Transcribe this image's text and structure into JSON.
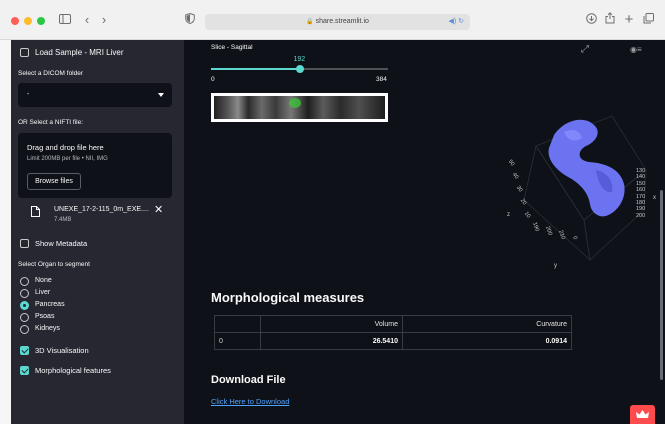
{
  "browser": {
    "url": "share.streamlit.io",
    "icons": [
      "sidebar-icon",
      "back-icon",
      "forward-icon",
      "shield-icon",
      "download-icon",
      "share-icon",
      "new-tab-icon",
      "tabs-icon"
    ]
  },
  "sidebar": {
    "load_sample_label": "Load Sample - MRI Liver",
    "dicom_label": "Select a DICOM folder",
    "dicom_value": "-",
    "nifti_label": "OR Select a NIFTI file:",
    "drop_title": "Drag and drop file here",
    "drop_hint": "Limit 200MB per file • NII, IMG",
    "browse_label": "Browse files",
    "file_name": "UNEXE_17-2-115_0m_EXE....",
    "file_size": "7.4MB",
    "show_metadata_label": "Show Metadata",
    "organ_label": "Select Organ to segment",
    "organs": [
      "None",
      "Liver",
      "Pancreas",
      "Psoas",
      "Kidneys"
    ],
    "organ_selected": "Pancreas",
    "vis3d_label": "3D Visualisation",
    "morph_label": "Morphological features"
  },
  "main": {
    "slider_label": "Slice - Sagittal",
    "slider_value": 192,
    "slider_min": "0",
    "slider_max": "384",
    "plot_axis_ticks_right": [
      "130",
      "140",
      "150",
      "160",
      "170",
      "180",
      "190",
      "200"
    ],
    "plot_axis_ticks_bottom": [
      "190",
      "200",
      "210",
      "0"
    ],
    "plot_axis_ticks_left": [
      "50",
      "40",
      "30",
      "20",
      "10"
    ],
    "plot_axis_labels": [
      "x",
      "z",
      "y"
    ],
    "morph_title": "Morphological measures",
    "table": {
      "headers": [
        "",
        "Volume",
        "Curvature"
      ],
      "rows": [
        [
          "0",
          "26.5410",
          "0.0914"
        ]
      ]
    },
    "download_title": "Download File",
    "download_link": "Click Here to Download"
  },
  "colors": {
    "accent": "#5bd8cf",
    "mesh": "#6b73f0",
    "sidebar_bg": "#262730",
    "main_bg": "#0e1117",
    "deploy": "#ff4b4b"
  }
}
